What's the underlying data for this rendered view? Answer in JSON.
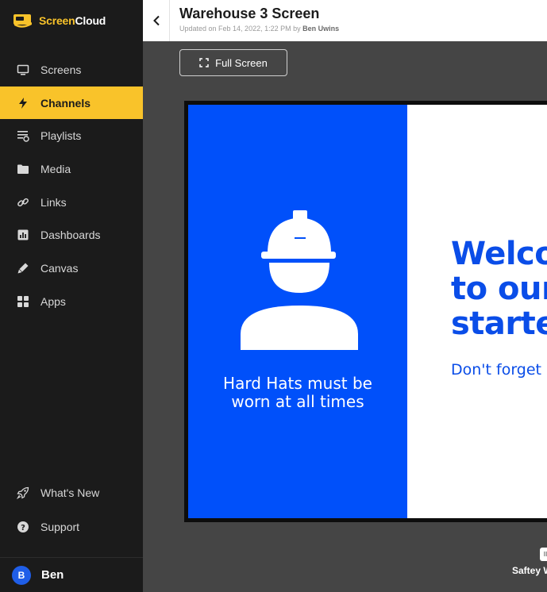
{
  "app": {
    "logo_part1": "Screen",
    "logo_part2": "Cloud",
    "brand_color": "#f9c32a"
  },
  "sidebar": {
    "items": [
      {
        "label": "Screens",
        "icon": "monitor-icon"
      },
      {
        "label": "Channels",
        "icon": "lightning-icon",
        "active": true
      },
      {
        "label": "Playlists",
        "icon": "playlist-icon"
      },
      {
        "label": "Media",
        "icon": "folder-icon"
      },
      {
        "label": "Links",
        "icon": "link-icon"
      },
      {
        "label": "Dashboards",
        "icon": "chart-icon"
      },
      {
        "label": "Canvas",
        "icon": "pen-icon"
      },
      {
        "label": "Apps",
        "icon": "grid-icon"
      }
    ],
    "bottom_items": [
      {
        "label": "What's New",
        "icon": "rocket-icon"
      },
      {
        "label": "Support",
        "icon": "question-icon"
      }
    ],
    "user": {
      "initial": "B",
      "name": "Ben"
    }
  },
  "header": {
    "title": "Warehouse 3 Screen",
    "updated_prefix": "Updated on Feb 14, 2022, 1:22 PM by ",
    "updated_by": "Ben Uwins"
  },
  "toolbar": {
    "fullscreen_label": "Full Screen"
  },
  "preview": {
    "left_caption_line1": "Hard Hats must be",
    "left_caption_line2": "worn at all times",
    "right_heading_line1": "Welco",
    "right_heading_line2": "to our",
    "right_heading_line3": "starte",
    "right_subtext": "Don't forget",
    "left_bg_color": "#0050fa"
  },
  "footer": {
    "badge_text": "II",
    "item_label": "Saftey W"
  }
}
